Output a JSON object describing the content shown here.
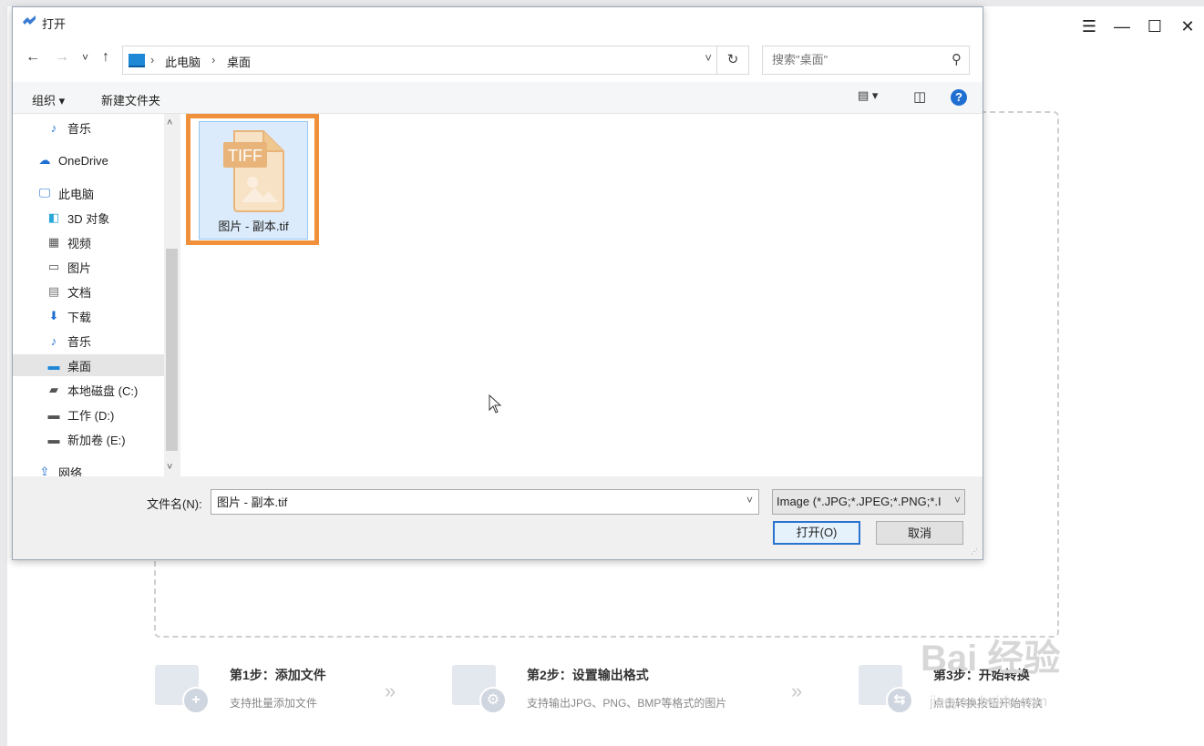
{
  "app": {
    "window_controls": [
      "☰",
      "—",
      "☐",
      "✕"
    ],
    "steps": [
      {
        "title": "第1步：添加文件",
        "sub": "支持批量添加文件",
        "badge": "+"
      },
      {
        "title": "第2步：设置输出格式",
        "sub": "支持输出JPG、PNG、BMP等格式的图片",
        "badge": "⚙"
      },
      {
        "title": "第3步：开始转换",
        "sub": "点击转换按钮开始转换",
        "badge": "⇆"
      }
    ],
    "step_arrow": "»",
    "watermark": "Bai 经验",
    "watermark_url": "jingyan.baidu.com"
  },
  "dialog": {
    "title": "打开",
    "nav": {
      "back": "←",
      "forward": "→",
      "recent": "˅",
      "up": "↑"
    },
    "address": {
      "crumbs": [
        "此电脑",
        "桌面"
      ],
      "separator": "›",
      "dropdown": "˅"
    },
    "refresh": "↻",
    "search": {
      "placeholder": "搜索\"桌面\"",
      "icon": "⚲"
    },
    "toolbar": {
      "organize": "组织 ▾",
      "new_folder": "新建文件夹",
      "view": "▤ ▾",
      "preview": "◫",
      "help": "?"
    },
    "sidebar": [
      {
        "label": "音乐",
        "icon": "♪"
      },
      {
        "label": "OneDrive",
        "icon": "☁"
      },
      {
        "label": "此电脑",
        "icon": "🖵"
      },
      {
        "label": "3D 对象",
        "icon": "◧"
      },
      {
        "label": "视频",
        "icon": "▦"
      },
      {
        "label": "图片",
        "icon": "▭"
      },
      {
        "label": "文档",
        "icon": "▤"
      },
      {
        "label": "下载",
        "icon": "⬇"
      },
      {
        "label": "音乐",
        "icon": "♪"
      },
      {
        "label": "桌面",
        "icon": "▬"
      },
      {
        "label": "本地磁盘 (C:)",
        "icon": "▰"
      },
      {
        "label": "工作 (D:)",
        "icon": "▬"
      },
      {
        "label": "新加卷 (E:)",
        "icon": "▬"
      },
      {
        "label": "网络",
        "icon": "⇪"
      }
    ],
    "scroll": {
      "up": "˄",
      "down": "˅"
    },
    "files": [
      {
        "name": "图片 - 副本.tif",
        "type_label": "TIFF"
      }
    ],
    "filename_label": "文件名(N):",
    "filename_value": "图片 - 副本.tif",
    "filter_value": "Image (*.JPG;*.JPEG;*.PNG;*.I",
    "open_button": "打开(O)",
    "cancel_button": "取消",
    "colors": {
      "accent": "#2a73cf",
      "highlight": "#f0903b",
      "tiff": "#e8b47a"
    }
  }
}
